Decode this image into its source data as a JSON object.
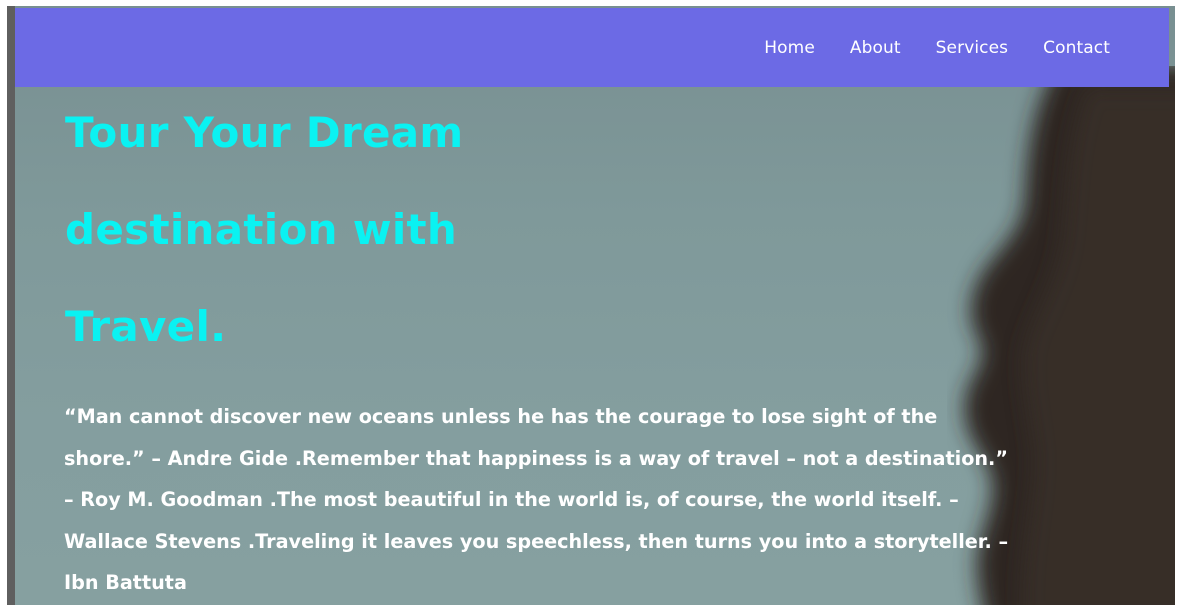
{
  "nav": {
    "links": [
      "Home",
      "About",
      "Services",
      "Contact"
    ]
  },
  "hero": {
    "title_lines": [
      "Tour Your Dream",
      "destination with",
      "Travel."
    ],
    "quote": "“Man cannot discover new oceans unless he has the courage to lose sight of the shore.” – Andre Gide .Remember that happiness is a way of travel – not a destination.” – Roy M. Goodman .The most beautiful in the world is, of course, the world itself. – Wallace Stevens .Traveling it leaves you speechless, then turns you into a storyteller. – Ibn Battuta"
  },
  "colors": {
    "navbar": "#6c6ae5",
    "title": "#0af2f2",
    "quote_text": "#ffffff",
    "background": "#809a9c"
  }
}
